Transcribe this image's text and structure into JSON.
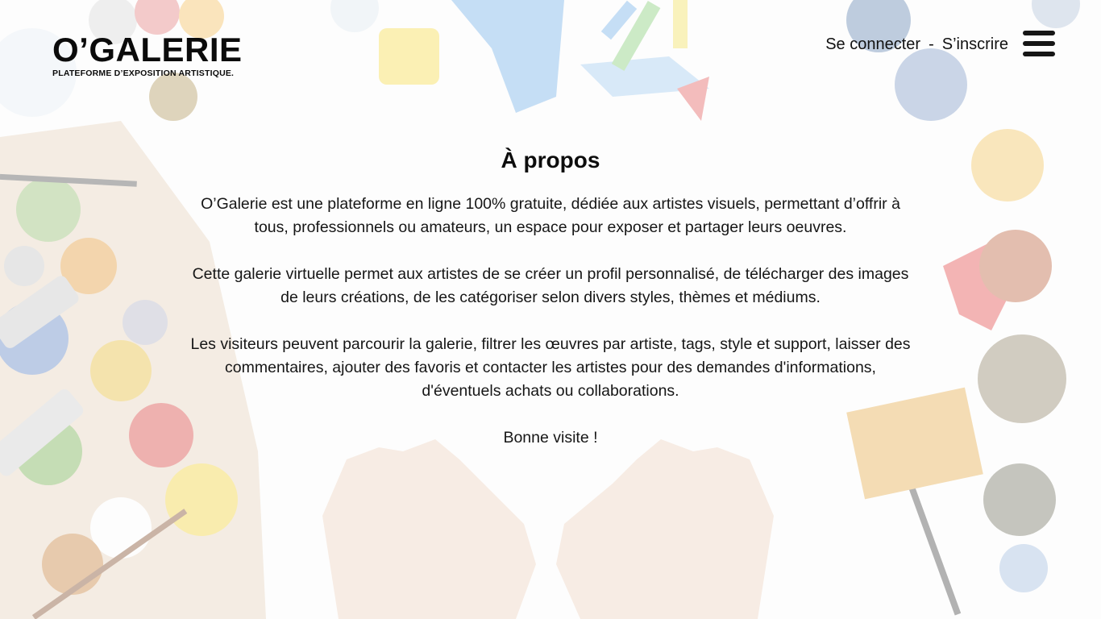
{
  "header": {
    "logo_title": "O’GALERIE",
    "logo_tagline": "PLATEFORME D’EXPOSITION ARTISTIQUE.",
    "login_label": "Se connecter",
    "separator": "-",
    "signup_label": "S’inscrire"
  },
  "main": {
    "title": "À propos",
    "paragraphs": [
      "O’Galerie est une plateforme en ligne 100% gratuite, dédiée aux artistes visuels, permettant d’offrir à tous, professionnels ou amateurs, un espace pour exposer et partager leurs oeuvres.",
      "Cette galerie virtuelle permet aux artistes de se créer un profil personnalisé, de télécharger des images de leurs créations, de les catégoriser selon divers styles, thèmes et médiums.",
      "Les visiteurs peuvent parcourir la galerie, filtrer les œuvres par artiste, tags, style et support, laisser des commentaires, ajouter des favoris et contacter les artistes pour des demandes d'informations, d'éventuels achats ou collaborations.",
      "Bonne visite !"
    ]
  },
  "icons": {
    "menu": "hamburger-menu-icon"
  }
}
